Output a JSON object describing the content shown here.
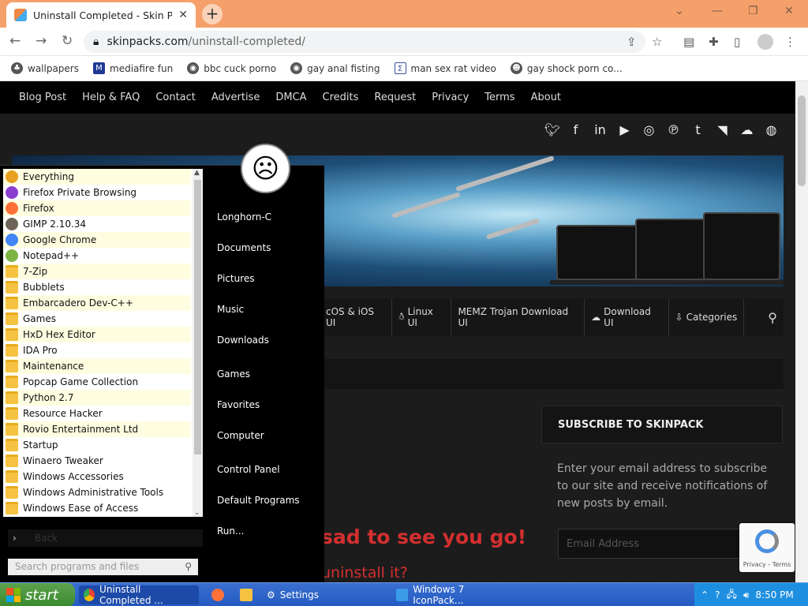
{
  "browser": {
    "tab_title": "Uninstall Completed - Skin Pack",
    "new_tab": "+",
    "url_domain": "skinpacks.com",
    "url_path": "/uninstall-completed/",
    "bookmarks": [
      "wallpapers",
      "mediafire fun",
      "bbc cuck porno",
      "gay anal fisting",
      "man sex rat video",
      "gay shock porn co..."
    ]
  },
  "site": {
    "nav": [
      "Blog Post",
      "Help & FAQ",
      "Contact",
      "Advertise",
      "DMCA",
      "Credits",
      "Request",
      "Privacy",
      "Terms",
      "About"
    ],
    "social_icons": [
      "twitter-icon",
      "facebook-icon",
      "linkedin-icon",
      "youtube-icon",
      "instagram-icon",
      "pinterest-icon",
      "tumblr-icon",
      "rss-icon",
      "soundcloud-icon",
      "dribbble-icon"
    ],
    "categories": [
      "cOS & iOS UI",
      "Linux UI",
      "MEMZ Trojan Download UI",
      "Download UI",
      "Categories"
    ],
    "subscribe_title": "SUBSCRIBE TO SKINPACK",
    "subscribe_text": "Enter your email address to subscribe to our site and receive notifications of new posts by email.",
    "email_placeholder": "Email Address",
    "sad_heading": "sad to see you go!",
    "uninstall_question": "uninstall it?",
    "recaptcha_text": "Privacy - Terms"
  },
  "start_menu": {
    "programs": [
      {
        "label": "Everything",
        "icon": "everything-icon",
        "color": "#e8a020"
      },
      {
        "label": "Firefox Private Browsing",
        "icon": "firefox-private-icon",
        "color": "#8a3fd1"
      },
      {
        "label": "Firefox",
        "icon": "firefox-icon",
        "color": "#ff7139"
      },
      {
        "label": "GIMP 2.10.34",
        "icon": "gimp-icon",
        "color": "#6d6457"
      },
      {
        "label": "Google Chrome",
        "icon": "chrome-icon",
        "color": "#4285f4"
      },
      {
        "label": "Notepad++",
        "icon": "notepadpp-icon",
        "color": "#7cb342"
      },
      {
        "label": "7-Zip",
        "icon": "folder-icon",
        "color": "folder"
      },
      {
        "label": "Bubblets",
        "icon": "folder-icon",
        "color": "folder"
      },
      {
        "label": "Embarcadero Dev-C++",
        "icon": "folder-icon",
        "color": "folder"
      },
      {
        "label": "Games",
        "icon": "folder-icon",
        "color": "folder"
      },
      {
        "label": "HxD Hex Editor",
        "icon": "folder-icon",
        "color": "folder"
      },
      {
        "label": "IDA Pro",
        "icon": "folder-icon",
        "color": "folder"
      },
      {
        "label": "Maintenance",
        "icon": "folder-icon",
        "color": "folder"
      },
      {
        "label": "Popcap Game Collection",
        "icon": "folder-icon",
        "color": "folder"
      },
      {
        "label": "Python 2.7",
        "icon": "folder-icon",
        "color": "folder"
      },
      {
        "label": "Resource Hacker",
        "icon": "folder-icon",
        "color": "folder"
      },
      {
        "label": "Rovio Entertainment Ltd",
        "icon": "folder-icon",
        "color": "folder"
      },
      {
        "label": "Startup",
        "icon": "folder-icon",
        "color": "folder"
      },
      {
        "label": "Winaero Tweaker",
        "icon": "folder-icon",
        "color": "folder"
      },
      {
        "label": "Windows Accessories",
        "icon": "folder-icon",
        "color": "folder"
      },
      {
        "label": "Windows Administrative Tools",
        "icon": "folder-icon",
        "color": "folder"
      },
      {
        "label": "Windows Ease of Access",
        "icon": "folder-icon",
        "color": "folder"
      }
    ],
    "back_label": "Back",
    "search_placeholder": "Search programs and files",
    "right_items": [
      "Longhorn-C",
      "Documents",
      "Pictures",
      "Music",
      "Downloads",
      "Games",
      "Favorites",
      "Computer",
      "Control Panel",
      "Default Programs",
      "Run..."
    ]
  },
  "taskbar": {
    "start_label": "start",
    "items": [
      "Uninstall Completed ...",
      "",
      "",
      "Settings",
      "Windows 7 IconPack..."
    ],
    "clock": "8:50 PM"
  }
}
